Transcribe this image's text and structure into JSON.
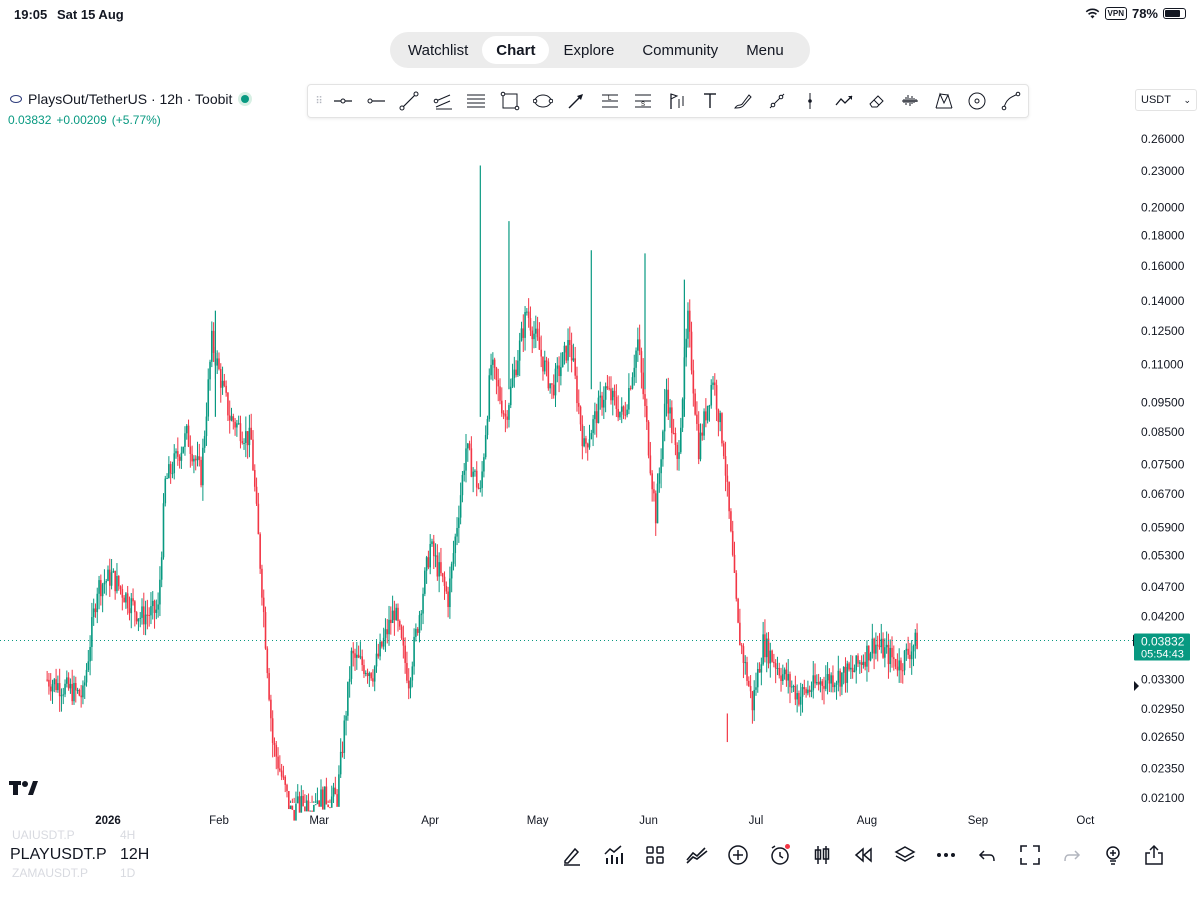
{
  "status_bar": {
    "time": "19:05",
    "date": "Sat 15 Aug",
    "vpn": "VPN",
    "battery": "78%",
    "battery_level": 0.78
  },
  "nav": {
    "tabs": [
      {
        "label": "Watchlist",
        "active": false
      },
      {
        "label": "Chart",
        "active": true
      },
      {
        "label": "Explore",
        "active": false
      },
      {
        "label": "Community",
        "active": false
      },
      {
        "label": "Menu",
        "active": false
      }
    ]
  },
  "symbol": {
    "title": "PlaysOut/TetherUS · 12h · Toobit",
    "last": "0.03832",
    "change": "+0.00209",
    "change_pct": "(+5.77%)"
  },
  "toolbar": {
    "tools": [
      "horizontal-line-icon",
      "horizontal-ray-icon",
      "trend-line-icon",
      "parallel-channel-icon",
      "fib-retracement-icon",
      "rectangle-icon",
      "ellipse-icon",
      "arrow-icon",
      "long-position-icon",
      "short-position-icon",
      "anchored-vwap-icon",
      "text-icon",
      "brush-icon",
      "trend-angle-icon",
      "vertical-line-icon",
      "path-icon",
      "eraser-icon",
      "volume-profile-icon",
      "xabcd-pattern-icon",
      "circle-icon",
      "curve-icon"
    ]
  },
  "currency": {
    "selected": "USDT"
  },
  "bottom": {
    "ghost_above": {
      "symbol": "UAIUSDT.P",
      "interval": "4H"
    },
    "current": {
      "symbol": "PLAYUSDT.P",
      "interval": "12H"
    },
    "ghost_below": {
      "symbol": "ZAMAUSDT.P",
      "interval": "1D"
    },
    "icons": [
      "draw-icon",
      "indicators-icon",
      "templates-icon",
      "compare-icon",
      "add-icon",
      "alert-icon",
      "chart-type-icon",
      "replay-icon",
      "layers-icon",
      "more-icon",
      "undo-icon",
      "fullscreen-icon",
      "redo-icon",
      "ideas-icon",
      "share-icon"
    ]
  },
  "chart_data": {
    "type": "candlestick",
    "scale": "log",
    "x_labels": [
      "2026",
      "Feb",
      "Mar",
      "Apr",
      "May",
      "Jun",
      "Jul",
      "Aug",
      "Sep",
      "Oct"
    ],
    "y_ticks": [
      "0.26000",
      "0.23000",
      "0.20000",
      "0.18000",
      "0.16000",
      "0.14000",
      "0.12500",
      "0.11000",
      "0.09500",
      "0.08500",
      "0.07500",
      "0.06700",
      "0.05900",
      "0.05300",
      "0.04700",
      "0.04200",
      "0.03300",
      "0.02950",
      "0.02650",
      "0.02350",
      "0.02100"
    ],
    "last_price": "0.03832",
    "countdown": "05:54:43",
    "colors": {
      "up": "#089981",
      "down": "#f23645",
      "last_price": "#089981"
    },
    "trend_points": [
      {
        "date": "2025-12-15",
        "price": 0.033
      },
      {
        "date": "2025-12-25",
        "price": 0.031
      },
      {
        "date": "2025-12-29",
        "price": 0.047
      },
      {
        "date": "2026-01-02",
        "price": 0.049
      },
      {
        "date": "2026-01-10",
        "price": 0.042
      },
      {
        "date": "2026-01-15",
        "price": 0.043
      },
      {
        "date": "2026-01-17",
        "price": 0.07
      },
      {
        "date": "2026-01-23",
        "price": 0.084
      },
      {
        "date": "2026-01-27",
        "price": 0.072
      },
      {
        "date": "2026-01-30",
        "price": 0.12
      },
      {
        "date": "2026-02-04",
        "price": 0.09
      },
      {
        "date": "2026-02-10",
        "price": 0.082
      },
      {
        "date": "2026-02-13",
        "price": 0.047
      },
      {
        "date": "2026-02-16",
        "price": 0.026
      },
      {
        "date": "2026-02-21",
        "price": 0.02
      },
      {
        "date": "2026-02-28",
        "price": 0.021
      },
      {
        "date": "2026-03-06",
        "price": 0.021
      },
      {
        "date": "2026-03-10",
        "price": 0.036
      },
      {
        "date": "2026-03-16",
        "price": 0.034
      },
      {
        "date": "2026-03-22",
        "price": 0.043
      },
      {
        "date": "2026-03-26",
        "price": 0.033
      },
      {
        "date": "2026-04-01",
        "price": 0.055
      },
      {
        "date": "2026-04-06",
        "price": 0.045
      },
      {
        "date": "2026-04-11",
        "price": 0.08
      },
      {
        "date": "2026-04-15",
        "price": 0.067
      },
      {
        "date": "2026-04-18",
        "price": 0.11
      },
      {
        "date": "2026-04-22",
        "price": 0.09
      },
      {
        "date": "2026-04-28",
        "price": 0.135
      },
      {
        "date": "2026-05-05",
        "price": 0.1
      },
      {
        "date": "2026-05-10",
        "price": 0.12
      },
      {
        "date": "2026-05-14",
        "price": 0.08
      },
      {
        "date": "2026-05-20",
        "price": 0.1
      },
      {
        "date": "2026-05-25",
        "price": 0.09
      },
      {
        "date": "2026-05-29",
        "price": 0.12
      },
      {
        "date": "2026-06-03",
        "price": 0.062
      },
      {
        "date": "2026-06-06",
        "price": 0.1
      },
      {
        "date": "2026-06-09",
        "price": 0.075
      },
      {
        "date": "2026-06-12",
        "price": 0.13
      },
      {
        "date": "2026-06-15",
        "price": 0.08
      },
      {
        "date": "2026-06-19",
        "price": 0.105
      },
      {
        "date": "2026-06-22",
        "price": 0.08
      },
      {
        "date": "2026-06-26",
        "price": 0.04
      },
      {
        "date": "2026-06-30",
        "price": 0.03
      },
      {
        "date": "2026-07-03",
        "price": 0.038
      },
      {
        "date": "2026-07-08",
        "price": 0.034
      },
      {
        "date": "2026-07-13",
        "price": 0.031
      },
      {
        "date": "2026-07-20",
        "price": 0.033
      },
      {
        "date": "2026-07-28",
        "price": 0.034
      },
      {
        "date": "2026-08-03",
        "price": 0.038
      },
      {
        "date": "2026-08-10",
        "price": 0.035
      },
      {
        "date": "2026-08-15",
        "price": 0.0383
      }
    ]
  }
}
